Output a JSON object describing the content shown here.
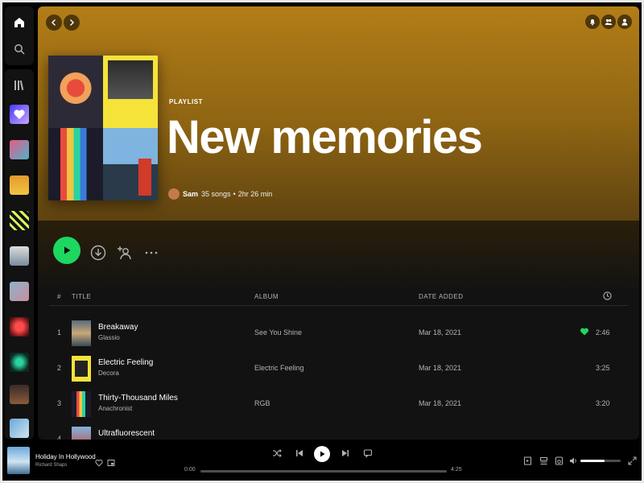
{
  "playlist": {
    "type_label": "PLAYLIST",
    "title": "New memories",
    "owner": "Sam",
    "song_count": "35 songs",
    "duration": "2hr 26 min",
    "separator": "•"
  },
  "table": {
    "headers": {
      "num": "#",
      "title": "TITLE",
      "album": "ALBUM",
      "date_added": "DATE ADDED",
      "duration_icon": "clock-icon"
    },
    "rows": [
      {
        "num": "1",
        "title": "Breakaway",
        "artist": "Glassio",
        "album": "See You Shine",
        "date_added": "Mar 18, 2021",
        "liked": true,
        "duration": "2:46"
      },
      {
        "num": "2",
        "title": "Electric Feeling",
        "artist": "Decora",
        "album": "Electric Feeling",
        "date_added": "Mar 18, 2021",
        "liked": false,
        "duration": "3:25"
      },
      {
        "num": "3",
        "title": "Thirty-Thousand Miles",
        "artist": "Anachronist",
        "album": "RGB",
        "date_added": "Mar 18, 2021",
        "liked": false,
        "duration": "3:20"
      },
      {
        "num": "4",
        "title": "Ultrafluorescent",
        "artist": "",
        "album": "",
        "date_added": "",
        "liked": false,
        "duration": ""
      }
    ]
  },
  "now_playing": {
    "title": "Holiday In Hollywood",
    "artist": "Richard Shaps",
    "elapsed": "0:00",
    "total": "4:25",
    "progress": 0,
    "volume": 0.6
  },
  "colors": {
    "accent": "#1ed760",
    "hero_top": "#b37d17",
    "background": "#121212"
  },
  "icons": [
    "home-icon",
    "search-icon",
    "library-icon",
    "chevron-left-icon",
    "chevron-right-icon",
    "bell-icon",
    "friends-icon",
    "user-icon",
    "play-icon",
    "download-icon",
    "add-user-icon",
    "more-icon",
    "heart-icon",
    "shuffle-icon",
    "previous-icon",
    "next-icon",
    "lyrics-icon",
    "queue-icon",
    "device-icon",
    "volume-icon",
    "fullscreen-icon",
    "pip-icon"
  ]
}
